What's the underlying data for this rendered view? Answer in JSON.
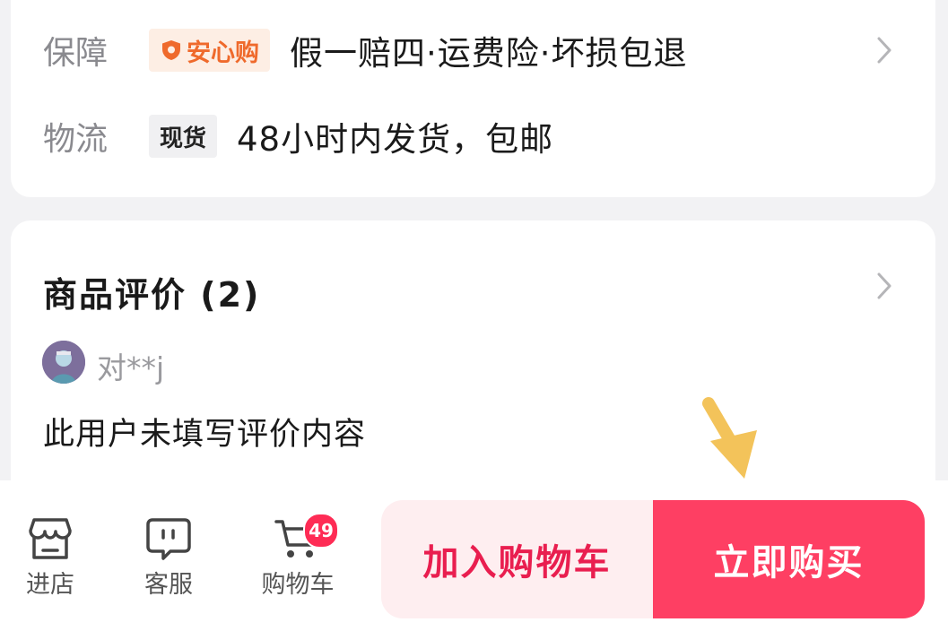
{
  "guarantee": {
    "label": "保障",
    "badge": "安心购",
    "text": "假一赔四·运费险·坏损包退"
  },
  "logistics": {
    "label": "物流",
    "badge": "现货",
    "text": "48小时内发货，包邮"
  },
  "reviews": {
    "title": "商品评价 (2)",
    "reviewer": "对**j",
    "content": "此用户未填写评价内容"
  },
  "bottom_bar": {
    "shop_label": "进店",
    "service_label": "客服",
    "cart_label": "购物车",
    "cart_count": "49",
    "add_to_cart": "加入购物车",
    "buy_now": "立即购买"
  },
  "colors": {
    "accent": "#fe3f63",
    "accent_light": "#feeef0",
    "anxin_orange": "#ef6a2c",
    "arrow": "#f3c35a"
  },
  "icons": {
    "guarantee_chevron": "chevron-right-icon",
    "review_chevron": "chevron-right-icon",
    "shop": "store-icon",
    "service": "chat-icon",
    "cart": "cart-icon",
    "pointer": "arrow-down-icon"
  }
}
